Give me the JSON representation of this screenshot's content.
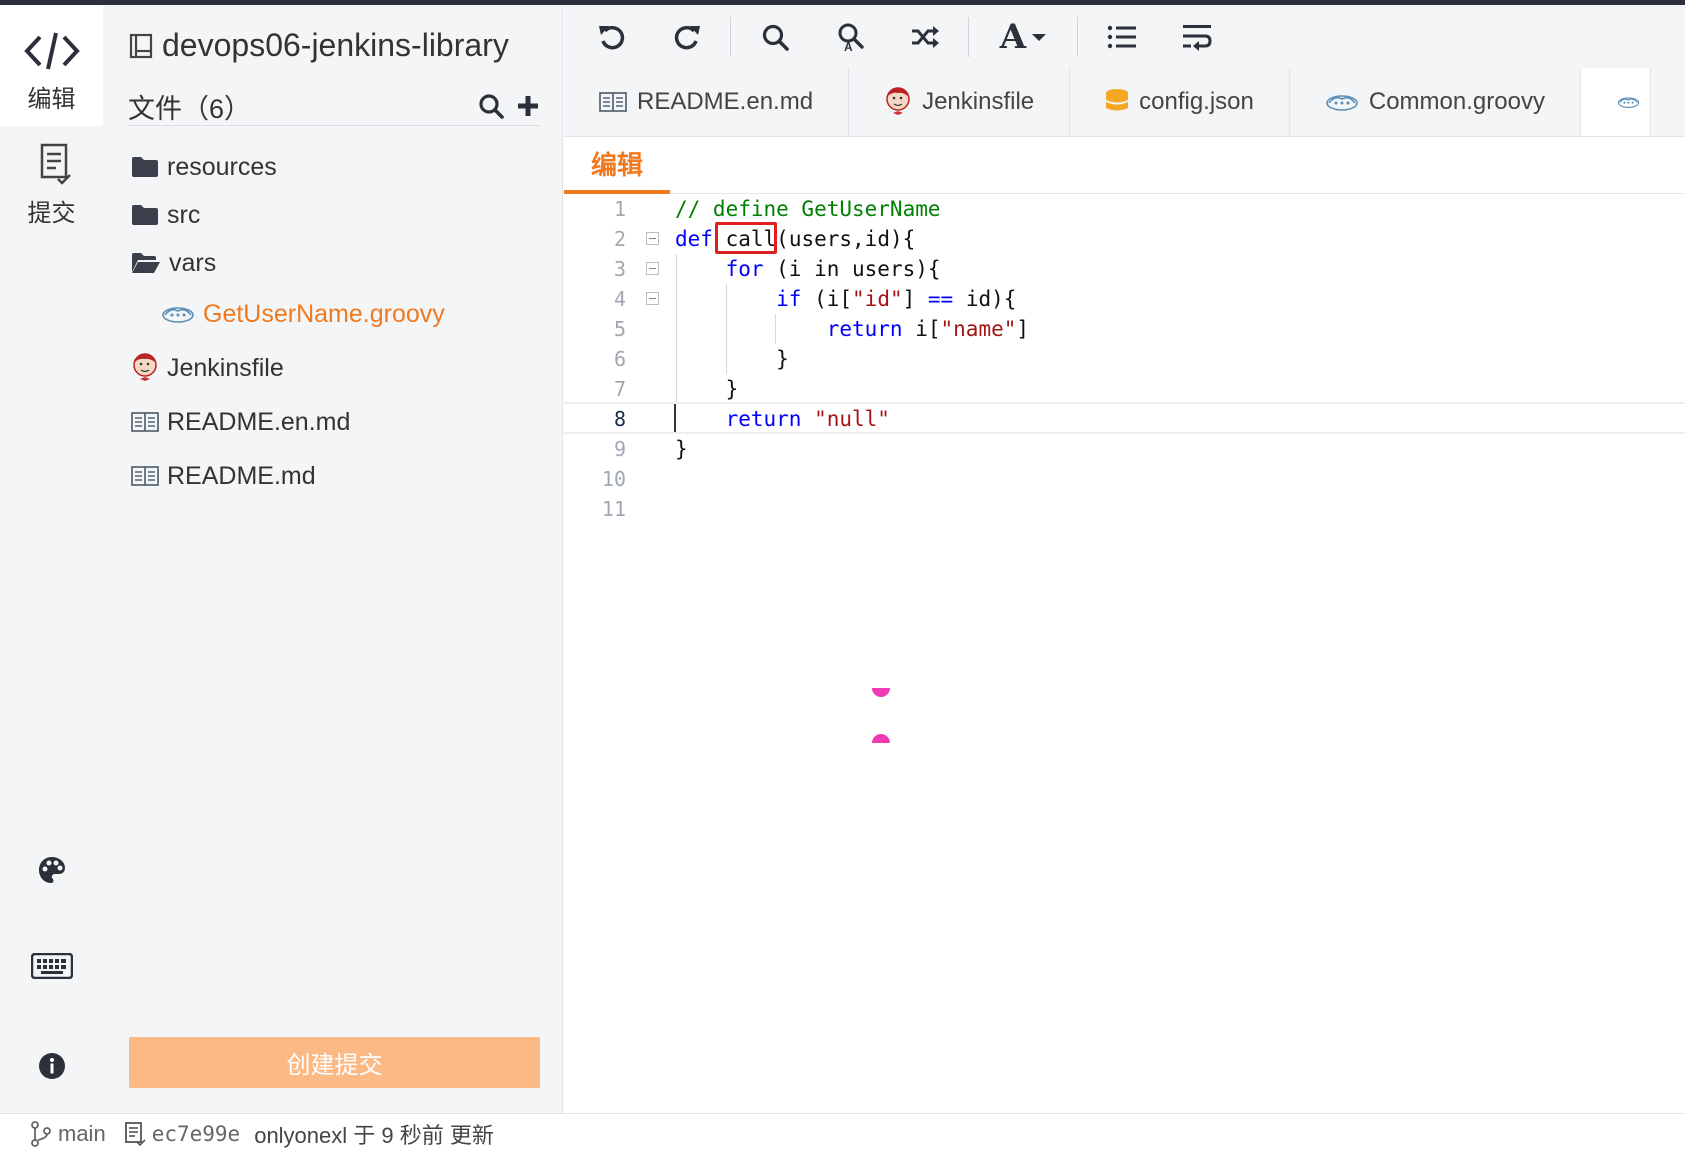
{
  "sidebar": {
    "edit_label": "编辑",
    "commit_label": "提交",
    "bottom_icons": [
      "palette-icon",
      "keyboard-icon",
      "info-icon"
    ]
  },
  "files": {
    "repo_name": "devops06-jenkins-library",
    "title": "文件（6）",
    "tree": [
      {
        "name": "resources",
        "type": "folder"
      },
      {
        "name": "src",
        "type": "folder"
      },
      {
        "name": "vars",
        "type": "folder-open"
      },
      {
        "name": "GetUserName.groovy",
        "type": "groovy",
        "active": true
      },
      {
        "name": "Jenkinsfile",
        "type": "jenkins"
      },
      {
        "name": "README.en.md",
        "type": "markdown"
      },
      {
        "name": "README.md",
        "type": "markdown"
      }
    ],
    "create_commit_label": "创建提交"
  },
  "toolbar": {
    "buttons": [
      "undo-icon",
      "redo-icon",
      "search-icon",
      "replace-icon",
      "shuffle-icon",
      "font-icon",
      "list-icon",
      "wrap-icon"
    ],
    "font_label": "A"
  },
  "tabs": [
    {
      "label": "README.en.md",
      "icon": "markdown-icon"
    },
    {
      "label": "Jenkinsfile",
      "icon": "jenkins-icon"
    },
    {
      "label": "config.json",
      "icon": "database-icon"
    },
    {
      "label": "Common.groovy",
      "icon": "groovy-icon"
    },
    {
      "label": "",
      "icon": "groovy-icon"
    }
  ],
  "editor": {
    "mode_tab": "编辑",
    "lines": [
      "1",
      "2",
      "3",
      "4",
      "5",
      "6",
      "7",
      "8",
      "9",
      "10",
      "11"
    ],
    "current_line": "8",
    "code": {
      "l1": "// define GetUserName",
      "l2_kw": "def",
      "l2_fn": "call",
      "l2_rest": "(users,id){",
      "l3_kw": "for",
      "l3_rest": " (i in users){",
      "l4_kw": "if",
      "l4_a": " (i[",
      "l4_str": "\"id\"",
      "l4_b": "] ",
      "l4_op": "==",
      "l4_c": " id){",
      "l5_kw": "return",
      "l5_a": " i[",
      "l5_str": "\"name\"",
      "l5_b": "]",
      "l6": "}",
      "l7": "}",
      "l8_kw": "return",
      "l8_str": "\"null\"",
      "l9": "}"
    }
  },
  "status": {
    "branch": "main",
    "commit": "ec7e99e",
    "message": "onlyonexl 于 9 秒前 更新"
  },
  "colors": {
    "accent": "#f07a20",
    "button_disabled": "#fdb984",
    "keyword": "#0000ff",
    "comment": "#008000",
    "string": "#a31515"
  }
}
